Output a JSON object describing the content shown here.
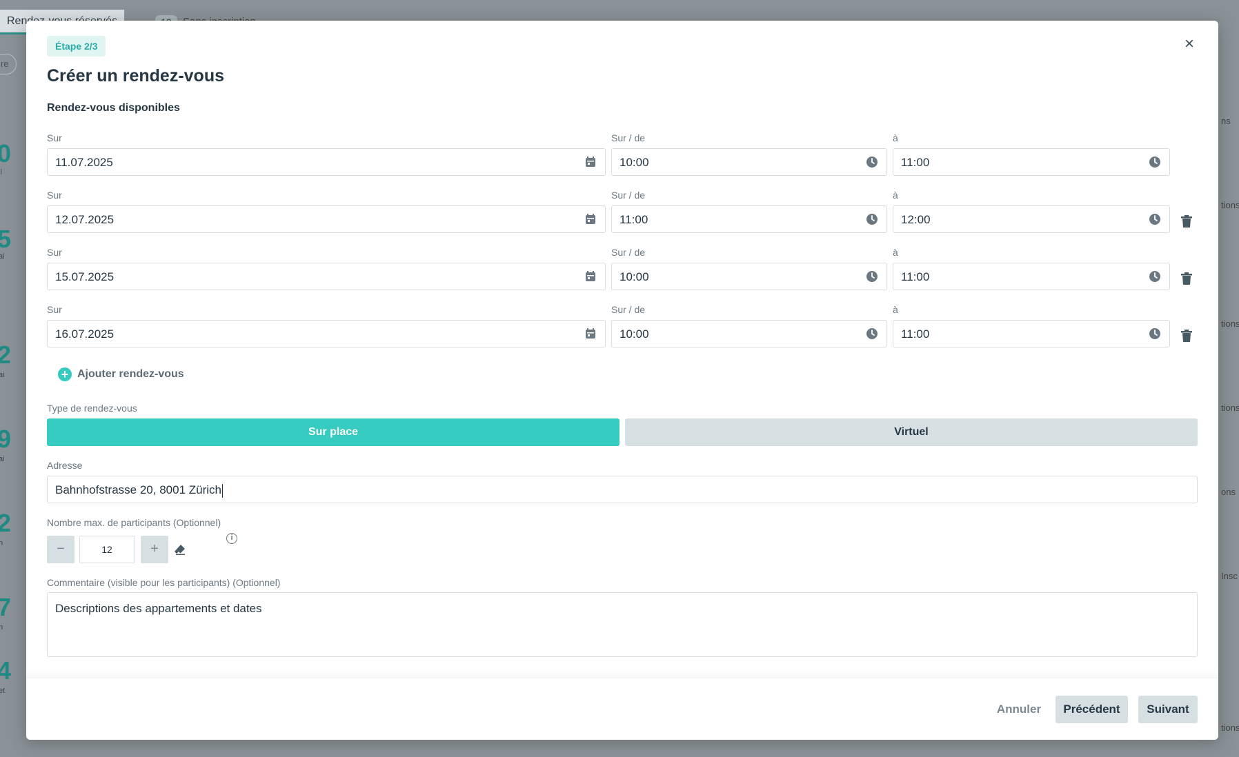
{
  "background": {
    "tab_label": "Rendez-vous réservés",
    "count": "10",
    "count_label": "Sans inscription",
    "filter_label": "re",
    "stats": [
      {
        "value": "0",
        "label": "il"
      },
      {
        "value": "5",
        "label": "ai"
      },
      {
        "value": "2",
        "label": "ai"
      },
      {
        "value": "9",
        "label": "ai"
      },
      {
        "value": "2",
        "label": "n"
      },
      {
        "value": "7",
        "label": "n"
      },
      {
        "value": "4",
        "label": "et"
      }
    ],
    "right_labels": [
      "ns",
      "tions",
      "tions",
      "tions",
      "ons",
      "Insc",
      "tions"
    ]
  },
  "modal": {
    "step": "Étape 2/3",
    "close_symbol": "×",
    "title": "Créer un rendez-vous",
    "section_title": "Rendez-vous disponibles",
    "label_date": "Sur",
    "label_from": "Sur / de",
    "label_to": "à",
    "appointments": [
      {
        "date": "11.07.2025",
        "from": "10:00",
        "to": "11:00",
        "deletable": false
      },
      {
        "date": "12.07.2025",
        "from": "11:00",
        "to": "12:00",
        "deletable": true
      },
      {
        "date": "15.07.2025",
        "from": "10:00",
        "to": "11:00",
        "deletable": true
      },
      {
        "date": "16.07.2025",
        "from": "10:00",
        "to": "11:00",
        "deletable": true
      }
    ],
    "add_label": "Ajouter rendez-vous",
    "type_label": "Type de rendez-vous",
    "type_options": [
      "Sur place",
      "Virtuel"
    ],
    "type_selected": "Sur place",
    "address_label": "Adresse",
    "address_value": "Bahnhofstrasse 20, 8001 Zürich",
    "max_label": "Nombre max. de participants (Optionnel)",
    "max_value": "12",
    "minus": "−",
    "plus": "+",
    "comment_label": "Commentaire (visible pour les participants) (Optionnel)",
    "comment_value": "Descriptions des appartements et dates",
    "accent_color": "#37ccc2"
  },
  "footer": {
    "cancel": "Annuler",
    "previous": "Précédent",
    "next": "Suivant"
  }
}
